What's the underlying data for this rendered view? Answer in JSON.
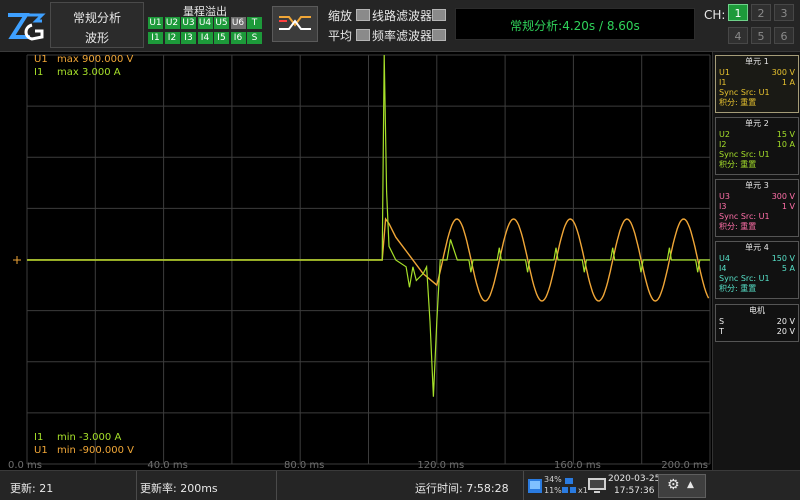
{
  "topbar": {
    "mode_line1": "常规分析",
    "mode_line2": "波形",
    "overrange_title": "量程溢出",
    "overrange_row1": [
      {
        "label": "U1",
        "on": true
      },
      {
        "label": "U2",
        "on": true
      },
      {
        "label": "U3",
        "on": true
      },
      {
        "label": "U4",
        "on": true
      },
      {
        "label": "U5",
        "on": true
      },
      {
        "label": "U6",
        "on": false
      },
      {
        "label": "T",
        "on": true
      }
    ],
    "overrange_row2": [
      {
        "label": "I1",
        "on": true
      },
      {
        "label": "I2",
        "on": true
      },
      {
        "label": "I3",
        "on": true
      },
      {
        "label": "I4",
        "on": true
      },
      {
        "label": "I5",
        "on": true
      },
      {
        "label": "I6",
        "on": true
      },
      {
        "label": "S",
        "on": true
      }
    ],
    "zoom_label": "缩放",
    "line_filter_label": "线路滤波器",
    "average_label": "平均",
    "freq_filter_label": "频率滤波器",
    "status_text": "常规分析:4.20s / 8.60s",
    "ch_label": "CH:",
    "ch_buttons": [
      {
        "label": "1",
        "active": true
      },
      {
        "label": "2",
        "active": false
      },
      {
        "label": "3",
        "active": false
      },
      {
        "label": "4",
        "active": false
      },
      {
        "label": "5",
        "active": false
      },
      {
        "label": "6",
        "active": false
      }
    ]
  },
  "plot": {
    "top_labels": [
      {
        "ch": "U1",
        "text": "max 900.000 V"
      },
      {
        "ch": "I1",
        "text": "max 3.000 A"
      }
    ],
    "bottom_labels": [
      {
        "ch": "I1",
        "text": "min -3.000 A"
      },
      {
        "ch": "U1",
        "text": "min -900.000 V"
      }
    ],
    "time_ticks": [
      "0.0 ms",
      "40.0 ms",
      "80.0 ms",
      "120.0 ms",
      "160.0 ms",
      "200.0 ms"
    ]
  },
  "chart_data": {
    "type": "line",
    "x_range_ms": [
      0,
      200
    ],
    "grid": true,
    "series": [
      {
        "name": "U1",
        "color": "#f0a637",
        "ylim": [
          -900,
          900
        ],
        "points_ms_V": [
          [
            0,
            0
          ],
          [
            104,
            0
          ],
          [
            105,
            180
          ],
          [
            106,
            160
          ],
          [
            108,
            100
          ],
          [
            112,
            20
          ],
          [
            116,
            -60
          ],
          [
            120,
            -110
          ]
        ],
        "sine": {
          "start_ms": 120,
          "end_ms": 200,
          "amplitude_V": 180,
          "period_ms": 16.6
        }
      },
      {
        "name": "I1",
        "color": "#a6e02a",
        "ylim": [
          -3,
          3
        ],
        "points_ms_A": [
          [
            0,
            0
          ],
          [
            104,
            0
          ],
          [
            104.6,
            3
          ],
          [
            105.3,
            1
          ],
          [
            106,
            0.2
          ],
          [
            108,
            0
          ],
          [
            111,
            -0.1
          ],
          [
            112,
            -0.4
          ],
          [
            113,
            -0.1
          ],
          [
            114,
            -0.3
          ],
          [
            116,
            -0.2
          ],
          [
            117,
            -0.1
          ],
          [
            118,
            -0.9
          ],
          [
            119,
            -2.0
          ],
          [
            120,
            -0.9
          ],
          [
            121,
            0
          ],
          [
            123,
            0
          ],
          [
            124,
            0.3
          ],
          [
            126,
            0
          ],
          [
            200,
            0
          ]
        ],
        "periodic_spikes": {
          "start_ms": 130,
          "period_ms": 8.3,
          "amplitude_A": 0.18
        }
      }
    ]
  },
  "units": [
    {
      "title": "单元 1",
      "color": "#e7c22e",
      "selected": true,
      "rows": [
        [
          "U1",
          "300 V"
        ],
        [
          "I1",
          "1 A"
        ],
        [
          "Sync Src: U1",
          ""
        ],
        [
          "积分: 重置",
          ""
        ]
      ]
    },
    {
      "title": "单元 2",
      "color": "#a6e02a",
      "selected": false,
      "rows": [
        [
          "U2",
          "15 V"
        ],
        [
          "I2",
          "10 A"
        ],
        [
          "Sync Src: U1",
          ""
        ],
        [
          "积分: 重置",
          ""
        ]
      ]
    },
    {
      "title": "单元 3",
      "color": "#ff6fa8",
      "selected": false,
      "rows": [
        [
          "U3",
          "300 V"
        ],
        [
          "I3",
          "1 V"
        ],
        [
          "Sync Src: U1",
          ""
        ],
        [
          "积分: 重置",
          ""
        ]
      ]
    },
    {
      "title": "单元 4",
      "color": "#56e0c8",
      "selected": false,
      "rows": [
        [
          "U4",
          "150 V"
        ],
        [
          "I4",
          "5 A"
        ],
        [
          "Sync Src: U1",
          ""
        ],
        [
          "积分: 重置",
          ""
        ]
      ]
    },
    {
      "title": "电机",
      "color": "#f0f0f0",
      "selected": false,
      "rows": [
        [
          "S",
          "20 V"
        ],
        [
          "T",
          "20 V"
        ]
      ]
    }
  ],
  "bottombar": {
    "update_count": "更新: 21",
    "update_rate": "更新率: 200ms",
    "run_time": "运行时间: 7:58:28",
    "cpu": "34%",
    "mem": "11%",
    "zoom": "x1",
    "date": "2020-03-25",
    "time": "17:57:36"
  }
}
